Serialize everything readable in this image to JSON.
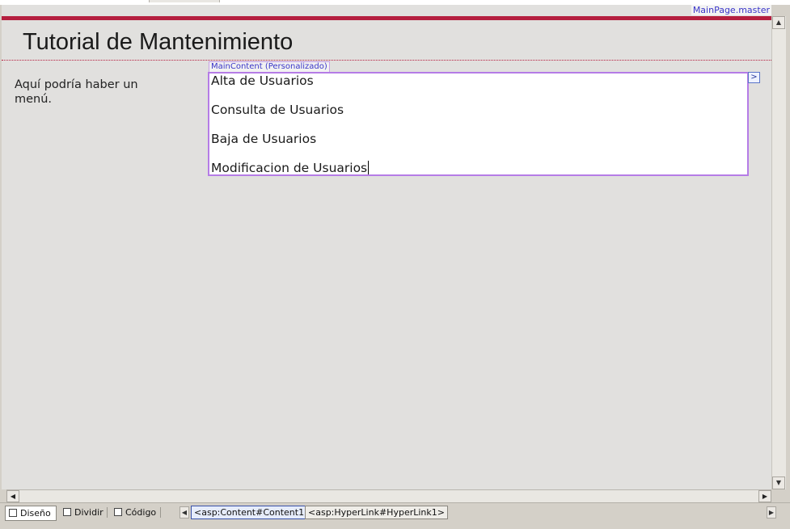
{
  "designer": {
    "master_page_label": "MainPage.master",
    "page_title": "Tutorial de Mantenimiento",
    "side_menu_text": "Aquí podría haber un menú.",
    "content_region_label": "MainContent (Personalizado)",
    "links": [
      "Alta de Usuarios",
      "Consulta de Usuarios",
      "Baja de Usuarios",
      "Modificacion de Usuarios"
    ],
    "smart_tag_glyph": ">"
  },
  "scrollbar": {
    "up": "▲",
    "down": "▼",
    "left": "◀",
    "right": "▶"
  },
  "view_tabs": [
    {
      "label": "Diseño",
      "icon": "design-view-icon",
      "active": true
    },
    {
      "label": "Dividir",
      "icon": "split-view-icon",
      "active": false
    },
    {
      "label": "Código",
      "icon": "code-view-icon",
      "active": false
    }
  ],
  "tag_navigator": {
    "prev": "◀",
    "next": "▶",
    "crumbs": [
      "<asp:Content#Content1>",
      "<asp:HyperLink#HyperLink1>"
    ]
  },
  "colors": {
    "accent_rule": "#b51f3f",
    "content_border": "#b57ce6",
    "designer_link_label": "#3a35c8"
  }
}
